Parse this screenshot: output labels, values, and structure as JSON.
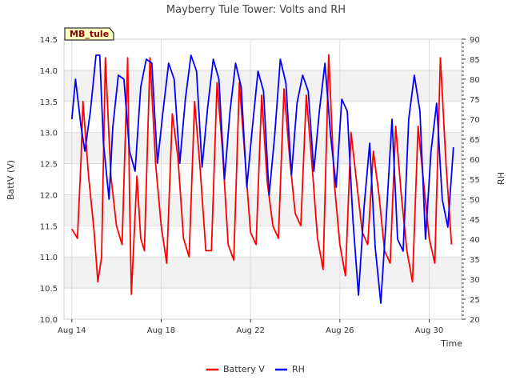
{
  "chart_data": {
    "type": "line",
    "title": "Mayberry Tule Tower: Volts and RH",
    "xlabel": "Time",
    "ylabel": "BattV (V)",
    "y2label": "RH",
    "site_label": "MB_tule",
    "x_ticks": [
      "Aug 14",
      "Aug 18",
      "Aug 22",
      "Aug 26",
      "Aug 30"
    ],
    "x_range_days": [
      "Aug 14",
      "Aug 31"
    ],
    "ylim": [
      10.0,
      14.5
    ],
    "y_ticks": [
      10.0,
      10.5,
      11.0,
      11.5,
      12.0,
      12.5,
      13.0,
      13.5,
      14.0,
      14.5
    ],
    "y2lim": [
      20,
      90
    ],
    "y2_ticks": [
      20,
      25,
      30,
      35,
      40,
      45,
      50,
      55,
      60,
      65,
      70,
      75,
      80,
      85,
      90
    ],
    "grid": true,
    "legend_position": "bottom",
    "series": [
      {
        "name": "Battery V",
        "axis": "left",
        "color": "#ff0000",
        "points": [
          [
            "Aug 14 00:00",
            11.45
          ],
          [
            "Aug 14 06:00",
            11.3
          ],
          [
            "Aug 14 10:00",
            12.6
          ],
          [
            "Aug 14 12:00",
            13.5
          ],
          [
            "Aug 14 18:00",
            12.3
          ],
          [
            "Aug 15 00:00",
            11.4
          ],
          [
            "Aug 15 04:00",
            10.6
          ],
          [
            "Aug 15 08:00",
            11.0
          ],
          [
            "Aug 15 12:00",
            14.2
          ],
          [
            "Aug 15 18:00",
            12.3
          ],
          [
            "Aug 16 00:00",
            11.5
          ],
          [
            "Aug 16 06:00",
            11.2
          ],
          [
            "Aug 16 12:00",
            14.2
          ],
          [
            "Aug 16 14:00",
            12.0
          ],
          [
            "Aug 16 16:00",
            10.4
          ],
          [
            "Aug 16 22:00",
            12.3
          ],
          [
            "Aug 17 02:00",
            11.3
          ],
          [
            "Aug 17 06:00",
            11.1
          ],
          [
            "Aug 17 12:00",
            14.2
          ],
          [
            "Aug 17 18:00",
            12.5
          ],
          [
            "Aug 18 00:00",
            11.5
          ],
          [
            "Aug 18 06:00",
            10.9
          ],
          [
            "Aug 18 12:00",
            13.3
          ],
          [
            "Aug 18 18:00",
            12.6
          ],
          [
            "Aug 19 00:00",
            11.3
          ],
          [
            "Aug 19 06:00",
            11.0
          ],
          [
            "Aug 19 12:00",
            13.5
          ],
          [
            "Aug 19 18:00",
            12.4
          ],
          [
            "Aug 20 00:00",
            11.1
          ],
          [
            "Aug 20 06:00",
            11.1
          ],
          [
            "Aug 20 12:00",
            13.8
          ],
          [
            "Aug 20 18:00",
            12.7
          ],
          [
            "Aug 21 00:00",
            11.2
          ],
          [
            "Aug 21 06:00",
            10.95
          ],
          [
            "Aug 21 12:00",
            13.8
          ],
          [
            "Aug 21 18:00",
            12.6
          ],
          [
            "Aug 22 00:00",
            11.4
          ],
          [
            "Aug 22 06:00",
            11.2
          ],
          [
            "Aug 22 12:00",
            13.6
          ],
          [
            "Aug 22 18:00",
            12.2
          ],
          [
            "Aug 23 00:00",
            11.5
          ],
          [
            "Aug 23 06:00",
            11.3
          ],
          [
            "Aug 23 12:00",
            13.7
          ],
          [
            "Aug 23 18:00",
            12.6
          ],
          [
            "Aug 24 00:00",
            11.7
          ],
          [
            "Aug 24 06:00",
            11.5
          ],
          [
            "Aug 24 12:00",
            13.6
          ],
          [
            "Aug 24 18:00",
            12.5
          ],
          [
            "Aug 25 00:00",
            11.3
          ],
          [
            "Aug 25 06:00",
            10.8
          ],
          [
            "Aug 25 12:00",
            14.25
          ],
          [
            "Aug 25 18:00",
            12.2
          ],
          [
            "Aug 26 00:00",
            11.2
          ],
          [
            "Aug 26 06:00",
            10.7
          ],
          [
            "Aug 26 12:00",
            13.0
          ],
          [
            "Aug 26 18:00",
            12.2
          ],
          [
            "Aug 27 00:00",
            11.4
          ],
          [
            "Aug 27 06:00",
            11.2
          ],
          [
            "Aug 27 12:00",
            12.7
          ],
          [
            "Aug 27 18:00",
            12.0
          ],
          [
            "Aug 28 00:00",
            11.1
          ],
          [
            "Aug 28 06:00",
            10.9
          ],
          [
            "Aug 28 12:00",
            13.1
          ],
          [
            "Aug 28 18:00",
            12.0
          ],
          [
            "Aug 29 00:00",
            11.1
          ],
          [
            "Aug 29 06:00",
            10.6
          ],
          [
            "Aug 29 12:00",
            13.1
          ],
          [
            "Aug 29 18:00",
            12.2
          ],
          [
            "Aug 30 00:00",
            11.3
          ],
          [
            "Aug 30 06:00",
            10.9
          ],
          [
            "Aug 30 12:00",
            14.2
          ],
          [
            "Aug 30 18:00",
            12.5
          ],
          [
            "Aug 31 00:00",
            11.2
          ]
        ]
      },
      {
        "name": "RH",
        "axis": "right",
        "color": "#0000ff",
        "points": [
          [
            "Aug 14 00:00",
            70
          ],
          [
            "Aug 14 04:00",
            80
          ],
          [
            "Aug 14 10:00",
            68
          ],
          [
            "Aug 14 14:00",
            62
          ],
          [
            "Aug 14 20:00",
            72
          ],
          [
            "Aug 15 02:00",
            86
          ],
          [
            "Aug 15 06:00",
            86
          ],
          [
            "Aug 15 10:00",
            64
          ],
          [
            "Aug 15 16:00",
            50
          ],
          [
            "Aug 15 20:00",
            68
          ],
          [
            "Aug 16 02:00",
            81
          ],
          [
            "Aug 16 08:00",
            80
          ],
          [
            "Aug 16 14:00",
            62
          ],
          [
            "Aug 16 20:00",
            57
          ],
          [
            "Aug 17 02:00",
            78
          ],
          [
            "Aug 17 08:00",
            85
          ],
          [
            "Aug 17 14:00",
            84
          ],
          [
            "Aug 17 20:00",
            59
          ],
          [
            "Aug 18 02:00",
            72
          ],
          [
            "Aug 18 08:00",
            84
          ],
          [
            "Aug 18 14:00",
            80
          ],
          [
            "Aug 18 20:00",
            59
          ],
          [
            "Aug 19 02:00",
            75
          ],
          [
            "Aug 19 08:00",
            86
          ],
          [
            "Aug 19 14:00",
            82
          ],
          [
            "Aug 19 20:00",
            58
          ],
          [
            "Aug 20 02:00",
            73
          ],
          [
            "Aug 20 08:00",
            85
          ],
          [
            "Aug 20 14:00",
            80
          ],
          [
            "Aug 20 20:00",
            55
          ],
          [
            "Aug 21 02:00",
            72
          ],
          [
            "Aug 21 08:00",
            84
          ],
          [
            "Aug 21 14:00",
            78
          ],
          [
            "Aug 21 20:00",
            53
          ],
          [
            "Aug 22 02:00",
            68
          ],
          [
            "Aug 22 08:00",
            82
          ],
          [
            "Aug 22 14:00",
            77
          ],
          [
            "Aug 22 20:00",
            51
          ],
          [
            "Aug 23 02:00",
            66
          ],
          [
            "Aug 23 08:00",
            85
          ],
          [
            "Aug 23 14:00",
            79
          ],
          [
            "Aug 23 20:00",
            56
          ],
          [
            "Aug 24 02:00",
            74
          ],
          [
            "Aug 24 08:00",
            81
          ],
          [
            "Aug 24 14:00",
            77
          ],
          [
            "Aug 24 20:00",
            57
          ],
          [
            "Aug 25 02:00",
            72
          ],
          [
            "Aug 25 08:00",
            84
          ],
          [
            "Aug 25 14:00",
            66
          ],
          [
            "Aug 25 20:00",
            53
          ],
          [
            "Aug 26 02:00",
            75
          ],
          [
            "Aug 26 08:00",
            72
          ],
          [
            "Aug 26 14:00",
            45
          ],
          [
            "Aug 26 20:00",
            26
          ],
          [
            "Aug 27 02:00",
            48
          ],
          [
            "Aug 27 08:00",
            64
          ],
          [
            "Aug 27 14:00",
            38
          ],
          [
            "Aug 27 20:00",
            24
          ],
          [
            "Aug 28 02:00",
            46
          ],
          [
            "Aug 28 08:00",
            70
          ],
          [
            "Aug 28 14:00",
            40
          ],
          [
            "Aug 28 20:00",
            37
          ],
          [
            "Aug 29 02:00",
            70
          ],
          [
            "Aug 29 08:00",
            81
          ],
          [
            "Aug 29 14:00",
            72
          ],
          [
            "Aug 29 20:00",
            40
          ],
          [
            "Aug 30 02:00",
            62
          ],
          [
            "Aug 30 08:00",
            74
          ],
          [
            "Aug 30 14:00",
            50
          ],
          [
            "Aug 30 20:00",
            43
          ],
          [
            "Aug 31 02:00",
            63
          ]
        ]
      }
    ]
  }
}
